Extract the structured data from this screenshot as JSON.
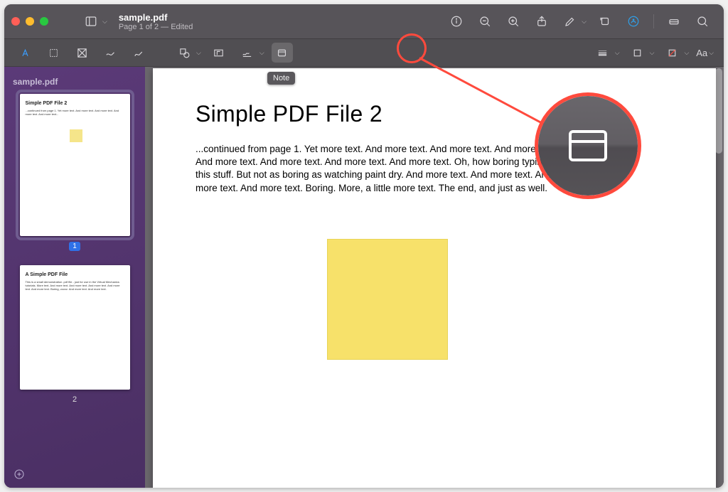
{
  "window": {
    "filename": "sample.pdf",
    "subtitle": "Page 1 of 2 — Edited"
  },
  "sidebar": {
    "title": "sample.pdf",
    "pages": [
      {
        "num": "1",
        "heading": "Simple PDF File 2",
        "selected": true
      },
      {
        "num": "2",
        "heading": "A Simple PDF File",
        "selected": false
      }
    ]
  },
  "document": {
    "heading": "Simple PDF File 2",
    "body": "...continued from page 1. Yet more text. And more text. And more text. And more text. And more text. And more text. And more text. And more text. Oh, how boring typing this stuff. But not as boring as watching paint dry. And more text. And more text. And more text. And more text. Boring.  More, a little more text. The end, and just as well."
  },
  "tooltip": {
    "note": "Note"
  },
  "markup": {
    "font_label": "Aa"
  },
  "colors": {
    "annotation": "#ff4a3d",
    "note": "#f7e16a",
    "accent_blue": "#2f71e8"
  }
}
